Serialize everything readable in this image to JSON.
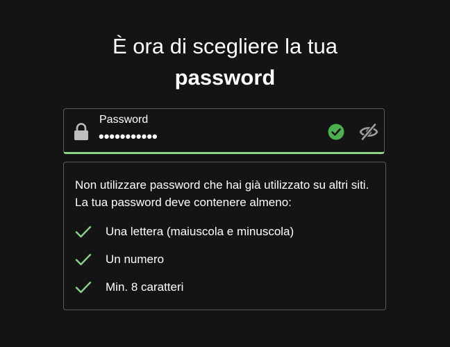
{
  "heading": {
    "line1": "È ora di scegliere la tua",
    "line2": "password"
  },
  "password_field": {
    "label": "Password",
    "value": "•••••••••••",
    "icons": {
      "leading": "lock-icon",
      "valid": "check-circle-icon",
      "toggle_visibility": "eye-slash-icon"
    }
  },
  "requirements": {
    "intro": "Non utilizzare password che hai già utilizzato su altri siti. La tua password deve contenere almeno:",
    "items": [
      {
        "text": "Una lettera (maiuscola e minuscola)",
        "met": true
      },
      {
        "text": "Un numero",
        "met": true
      },
      {
        "text": "Min. 8 caratteri",
        "met": true
      }
    ]
  },
  "colors": {
    "background": "#141414",
    "accent_green": "#4caf50",
    "light_green": "#8fd48b",
    "border": "#5a5a5a"
  }
}
